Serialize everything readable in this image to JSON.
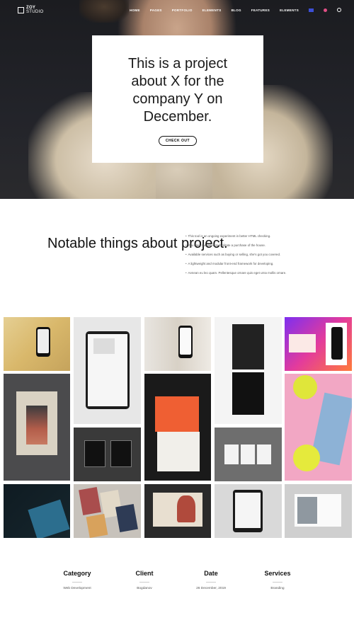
{
  "nav": {
    "logo_line1": "ZOY",
    "logo_line2": "STUDIO",
    "items": [
      "HOME",
      "PAGES",
      "PORTFOLIO",
      "ELEMENTS",
      "BLOG",
      "FEATURES",
      "ELEMENTS"
    ]
  },
  "hero": {
    "title": "This is a project about X for the company Y on December.",
    "cta": "CHECK OUT"
  },
  "notable": {
    "title": "Notable things about project.",
    "items": [
      "This tool is an ongoing experiment in better HTML checking.",
      "You have managed to facilitate a purchase of the house.",
      "Available services such as buying or selling, she's got you covered.",
      "A lightweight and modular front-end framework for developing.",
      "Aenean eu leo quam. Pellentesque ornare quis eget urna mollis ornare."
    ]
  },
  "info": [
    {
      "heading": "Category",
      "value": "Web Development"
    },
    {
      "heading": "Client",
      "value": "Bogdanov"
    },
    {
      "heading": "Date",
      "value": "26 December, 2019"
    },
    {
      "heading": "Services",
      "value": "Branding"
    }
  ],
  "colors": {
    "accent_flag": "#3c4fd6",
    "dribbble": "#e24f86"
  }
}
